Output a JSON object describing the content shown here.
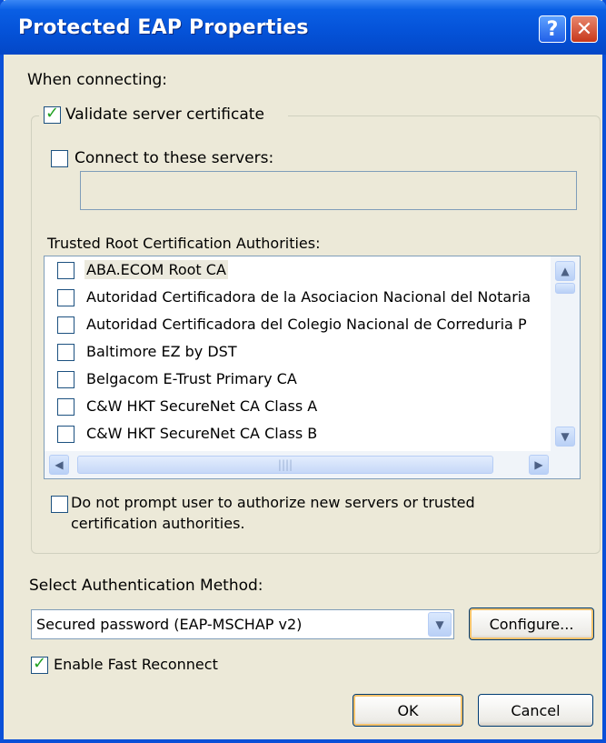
{
  "window": {
    "title": "Protected EAP Properties",
    "help_glyph": "?",
    "close_glyph": "✕"
  },
  "labels": {
    "when_connecting": "When connecting:",
    "trusted_root": "Trusted Root Certification Authorities:",
    "select_auth_method": "Select Authentication Method:"
  },
  "validate_server_cert": {
    "label": "Validate server certificate",
    "checked": true
  },
  "connect_to_servers": {
    "label": "Connect to these servers:",
    "checked": false,
    "value": ""
  },
  "ca_list": [
    {
      "label": "ABA.ECOM Root CA",
      "checked": false,
      "selected": true
    },
    {
      "label": "Autoridad Certificadora de la Asociacion Nacional del Notaria",
      "checked": false,
      "selected": false
    },
    {
      "label": "Autoridad Certificadora del Colegio Nacional de Correduria P",
      "checked": false,
      "selected": false
    },
    {
      "label": "Baltimore EZ by DST",
      "checked": false,
      "selected": false
    },
    {
      "label": "Belgacom E-Trust Primary CA",
      "checked": false,
      "selected": false
    },
    {
      "label": "C&W HKT SecureNet CA Class A",
      "checked": false,
      "selected": false
    },
    {
      "label": "C&W HKT SecureNet CA Class B",
      "checked": false,
      "selected": false
    }
  ],
  "scroll": {
    "up": "▲",
    "down": "▼",
    "left": "◀",
    "right": "▶",
    "grip": "||||"
  },
  "do_not_prompt": {
    "line1": "Do not prompt user to authorize new servers or trusted",
    "line2": "certification authorities.",
    "checked": false
  },
  "auth_method": {
    "selected": "Secured password (EAP-MSCHAP v2)",
    "arrow": "▼"
  },
  "configure_button": "Configure...",
  "enable_fast_reconnect": {
    "label": "Enable Fast Reconnect",
    "checked": true
  },
  "ok_button": "OK",
  "cancel_button": "Cancel",
  "check_glyph": "✓"
}
